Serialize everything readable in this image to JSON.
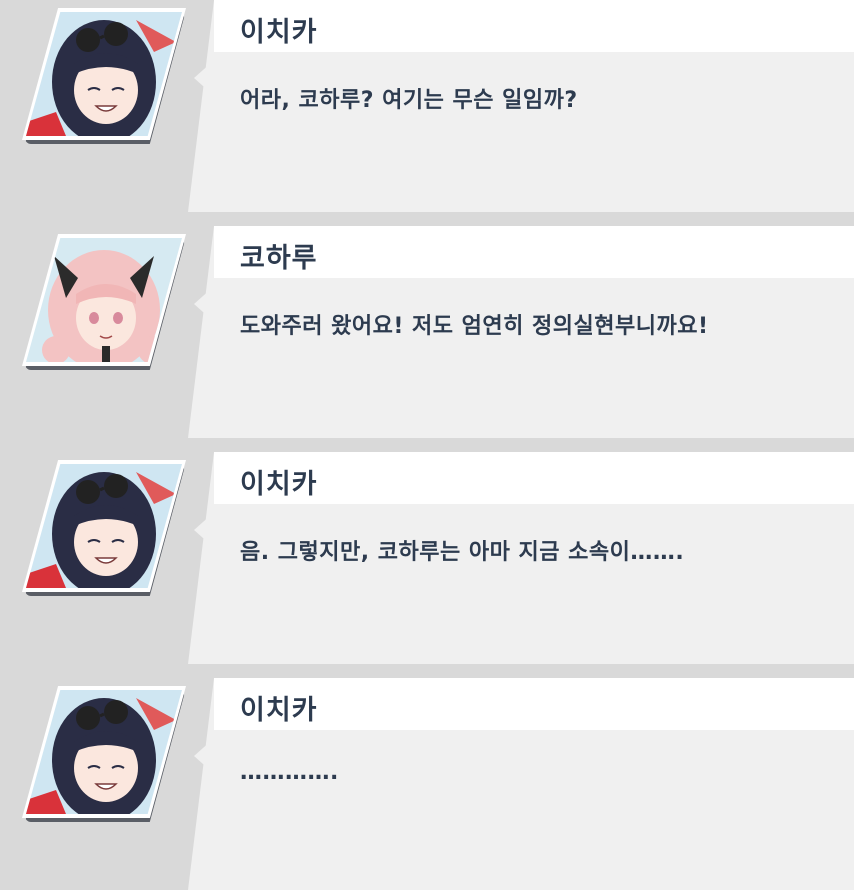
{
  "messages": [
    {
      "speaker": "이치카",
      "avatar": "ichika-portrait",
      "text": "어라, 코하루? 여기는 무슨 일임까?"
    },
    {
      "speaker": "코하루",
      "avatar": "koharu-portrait",
      "text": "도와주러 왔어요! 저도 엄연히 정의실현부니까요!"
    },
    {
      "speaker": "이치카",
      "avatar": "ichika-portrait",
      "text": "음. 그렇지만, 코하루는 아마 지금 소속이……."
    },
    {
      "speaker": "이치카",
      "avatar": "ichika-portrait",
      "text": "…………."
    }
  ],
  "colors": {
    "background": "#d9d9d9",
    "bubble": "#f0f0f0",
    "name_bar": "#ffffff",
    "text": "#2d3b4f"
  }
}
